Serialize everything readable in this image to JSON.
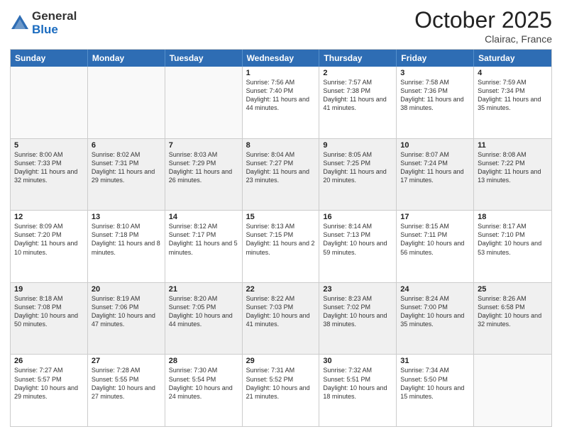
{
  "header": {
    "logo_general": "General",
    "logo_blue": "Blue",
    "month_title": "October 2025",
    "location": "Clairac, France"
  },
  "days_of_week": [
    "Sunday",
    "Monday",
    "Tuesday",
    "Wednesday",
    "Thursday",
    "Friday",
    "Saturday"
  ],
  "rows": [
    [
      {
        "day": "",
        "empty": true
      },
      {
        "day": "",
        "empty": true
      },
      {
        "day": "",
        "empty": true
      },
      {
        "day": "1",
        "sunrise": "7:56 AM",
        "sunset": "7:40 PM",
        "daylight": "11 hours and 44 minutes."
      },
      {
        "day": "2",
        "sunrise": "7:57 AM",
        "sunset": "7:38 PM",
        "daylight": "11 hours and 41 minutes."
      },
      {
        "day": "3",
        "sunrise": "7:58 AM",
        "sunset": "7:36 PM",
        "daylight": "11 hours and 38 minutes."
      },
      {
        "day": "4",
        "sunrise": "7:59 AM",
        "sunset": "7:34 PM",
        "daylight": "11 hours and 35 minutes."
      }
    ],
    [
      {
        "day": "5",
        "sunrise": "8:00 AM",
        "sunset": "7:33 PM",
        "daylight": "11 hours and 32 minutes."
      },
      {
        "day": "6",
        "sunrise": "8:02 AM",
        "sunset": "7:31 PM",
        "daylight": "11 hours and 29 minutes."
      },
      {
        "day": "7",
        "sunrise": "8:03 AM",
        "sunset": "7:29 PM",
        "daylight": "11 hours and 26 minutes."
      },
      {
        "day": "8",
        "sunrise": "8:04 AM",
        "sunset": "7:27 PM",
        "daylight": "11 hours and 23 minutes."
      },
      {
        "day": "9",
        "sunrise": "8:05 AM",
        "sunset": "7:25 PM",
        "daylight": "11 hours and 20 minutes."
      },
      {
        "day": "10",
        "sunrise": "8:07 AM",
        "sunset": "7:24 PM",
        "daylight": "11 hours and 17 minutes."
      },
      {
        "day": "11",
        "sunrise": "8:08 AM",
        "sunset": "7:22 PM",
        "daylight": "11 hours and 13 minutes."
      }
    ],
    [
      {
        "day": "12",
        "sunrise": "8:09 AM",
        "sunset": "7:20 PM",
        "daylight": "11 hours and 10 minutes."
      },
      {
        "day": "13",
        "sunrise": "8:10 AM",
        "sunset": "7:18 PM",
        "daylight": "11 hours and 8 minutes."
      },
      {
        "day": "14",
        "sunrise": "8:12 AM",
        "sunset": "7:17 PM",
        "daylight": "11 hours and 5 minutes."
      },
      {
        "day": "15",
        "sunrise": "8:13 AM",
        "sunset": "7:15 PM",
        "daylight": "11 hours and 2 minutes."
      },
      {
        "day": "16",
        "sunrise": "8:14 AM",
        "sunset": "7:13 PM",
        "daylight": "10 hours and 59 minutes."
      },
      {
        "day": "17",
        "sunrise": "8:15 AM",
        "sunset": "7:11 PM",
        "daylight": "10 hours and 56 minutes."
      },
      {
        "day": "18",
        "sunrise": "8:17 AM",
        "sunset": "7:10 PM",
        "daylight": "10 hours and 53 minutes."
      }
    ],
    [
      {
        "day": "19",
        "sunrise": "8:18 AM",
        "sunset": "7:08 PM",
        "daylight": "10 hours and 50 minutes."
      },
      {
        "day": "20",
        "sunrise": "8:19 AM",
        "sunset": "7:06 PM",
        "daylight": "10 hours and 47 minutes."
      },
      {
        "day": "21",
        "sunrise": "8:20 AM",
        "sunset": "7:05 PM",
        "daylight": "10 hours and 44 minutes."
      },
      {
        "day": "22",
        "sunrise": "8:22 AM",
        "sunset": "7:03 PM",
        "daylight": "10 hours and 41 minutes."
      },
      {
        "day": "23",
        "sunrise": "8:23 AM",
        "sunset": "7:02 PM",
        "daylight": "10 hours and 38 minutes."
      },
      {
        "day": "24",
        "sunrise": "8:24 AM",
        "sunset": "7:00 PM",
        "daylight": "10 hours and 35 minutes."
      },
      {
        "day": "25",
        "sunrise": "8:26 AM",
        "sunset": "6:58 PM",
        "daylight": "10 hours and 32 minutes."
      }
    ],
    [
      {
        "day": "26",
        "sunrise": "7:27 AM",
        "sunset": "5:57 PM",
        "daylight": "10 hours and 29 minutes."
      },
      {
        "day": "27",
        "sunrise": "7:28 AM",
        "sunset": "5:55 PM",
        "daylight": "10 hours and 27 minutes."
      },
      {
        "day": "28",
        "sunrise": "7:30 AM",
        "sunset": "5:54 PM",
        "daylight": "10 hours and 24 minutes."
      },
      {
        "day": "29",
        "sunrise": "7:31 AM",
        "sunset": "5:52 PM",
        "daylight": "10 hours and 21 minutes."
      },
      {
        "day": "30",
        "sunrise": "7:32 AM",
        "sunset": "5:51 PM",
        "daylight": "10 hours and 18 minutes."
      },
      {
        "day": "31",
        "sunrise": "7:34 AM",
        "sunset": "5:50 PM",
        "daylight": "10 hours and 15 minutes."
      },
      {
        "day": "",
        "empty": true
      }
    ]
  ]
}
